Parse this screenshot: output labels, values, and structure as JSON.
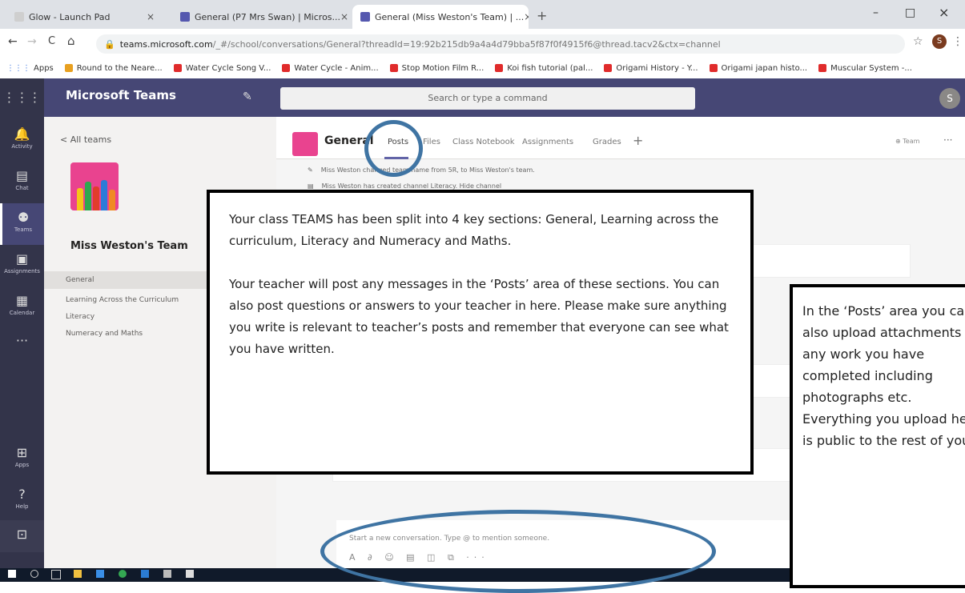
{
  "browser": {
    "tabs": [
      {
        "label": "Glow - Launch Pad",
        "close": "×",
        "favicon_color": "#d0d0d0"
      },
      {
        "label": "General (P7 Mrs Swan) | Micros...",
        "close": "×",
        "favicon_color": "#5558af"
      },
      {
        "label": "General (Miss Weston's Team) | ...",
        "close": "×",
        "favicon_color": "#5558af"
      }
    ],
    "new_tab": "+",
    "window_controls": [
      "–",
      "□",
      "×"
    ],
    "nav": {
      "back": "←",
      "forward": "→",
      "reload": "C",
      "home": "⌂"
    },
    "url_host": "teams.microsoft.com",
    "url_rest": "/_#/school/conversations/General?threadId=19:92b215db9a4a4d79bba5f87f0f4915f6@thread.tacv2&ctx=channel",
    "profile_initial": "S",
    "bookmarks": [
      "Apps",
      "Round to the Neare...",
      "Water Cycle Song V...",
      "Water Cycle - Anim...",
      "Stop Motion Film R...",
      "Koi fish tutorial (pal...",
      "Origami History - Y...",
      "Origami japan histo...",
      "Muscular System -..."
    ]
  },
  "teams": {
    "app_title": "Microsoft Teams",
    "search_placeholder": "Search or type a command",
    "user_initial": "S",
    "rail": [
      {
        "label": "Activity",
        "icon": "bell-icon",
        "glyph": "🔔"
      },
      {
        "label": "Chat",
        "icon": "chat-icon",
        "glyph": "▤"
      },
      {
        "label": "Teams",
        "icon": "teams-icon",
        "glyph": "⚉"
      },
      {
        "label": "Assignments",
        "icon": "assignments-icon",
        "glyph": "▣"
      },
      {
        "label": "Calendar",
        "icon": "calendar-icon",
        "glyph": "▦"
      },
      {
        "label": "",
        "icon": "more-icon",
        "glyph": "···"
      }
    ],
    "rail_bottom": [
      {
        "label": "Apps",
        "icon": "apps-icon",
        "glyph": "⊞"
      },
      {
        "label": "Help",
        "icon": "help-icon",
        "glyph": "?"
      },
      {
        "label": "",
        "icon": "download-icon",
        "glyph": "⊡"
      }
    ],
    "all_teams": "< All teams",
    "team_name": "Miss Weston's Team",
    "channels": [
      "General",
      "Learning Across the Curriculum",
      "Literacy",
      "Numeracy and Maths"
    ],
    "channel_title": "General",
    "channel_tabs": [
      "Posts",
      "Files",
      "Class Notebook",
      "Assignments",
      "Grades",
      "+"
    ],
    "team_button": "⊕ Team",
    "more": "···",
    "system_messages": [
      "Miss Weston changed team name from 5R, to Miss Weston's team.",
      "Miss Weston has created channel Literacy. Hide channel"
    ],
    "compose_placeholder": "Start a new conversation. Type @ to mention someone.",
    "compose_tools": "A  ∂  ☺  ▤  ◫  ⧉  ···"
  },
  "callouts": {
    "box1_para1": "Your class TEAMS has been split into 4 key sections: General, Learning across the curriculum, Literacy and Numeracy and Maths.",
    "box1_para2": "Your teacher will post any messages in the ‘Posts’ area of these sections. You can also post questions or answers to your teacher in here. Please make sure anything you write is relevant to teacher’s posts and remember that everyone can see what you have written.",
    "box2": "In the ‘Posts’ area you can also upload attachments of any work you have completed including photographs etc. Everything you upload here is public to the rest of your"
  },
  "colors": {
    "rail": "#33344a",
    "topbar": "#464775",
    "accent": "#6264a7",
    "team_logo": "#e9438f",
    "ring": "#3f74a3"
  }
}
